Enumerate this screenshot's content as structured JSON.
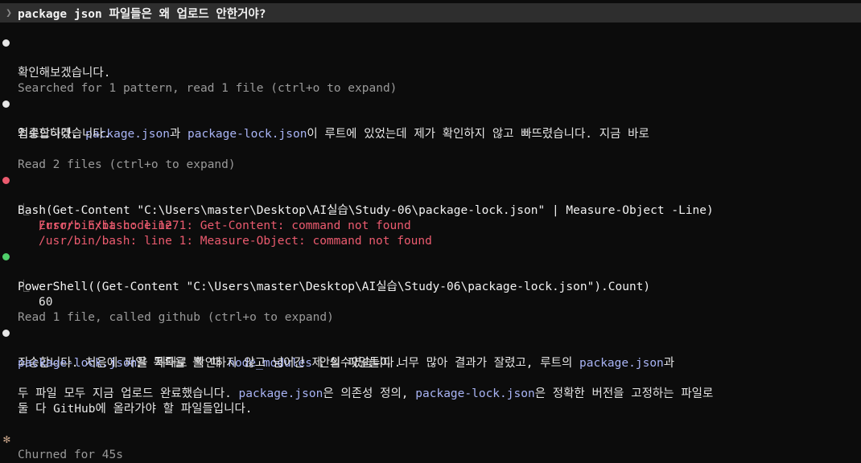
{
  "prompt": {
    "text": "package json 파일들은 왜 업로드 안한거야?"
  },
  "messages": {
    "m1": "확인해보겠습니다.",
    "search_summary": "Searched for 1 pattern, read 1 file (ctrl+o to expand)",
    "m2": {
      "pre": "죄송합니다. ",
      "c1": "package.json",
      "mid1": "과 ",
      "c2": "package-lock.json",
      "post": "이 루트에 있었는데 제가 확인하지 않고 빠뜨렸습니다. 지금 바로",
      "line2": "업로드하겠습니다."
    },
    "read_summary": "Read 2 files (ctrl+o to expand)",
    "bash": {
      "call": "Bash(Get-Content \"C:\\Users\\master\\Desktop\\AI실습\\Study-06\\package-lock.json\" | Measure-Object -Line)",
      "elbow": "⎿",
      "err1": "Error: Exit code 127",
      "err2": "/usr/bin/bash: line 1: Get-Content: command not found",
      "err3": "/usr/bin/bash: line 1: Measure-Object: command not found"
    },
    "powershell": {
      "call": "PowerShell((Get-Content \"C:\\Users\\master\\Desktop\\AI실습\\Study-06\\package-lock.json\").Count)",
      "elbow": "⎿",
      "result": "60"
    },
    "read_github_summary": "Read 1 file, called github (ctrl+o to expand)",
    "m3": {
      "pre": "죄송합니다. 처음에 파일 목록을 볼 때 ",
      "c1": "node_modules",
      "mid1": " 안의 파일들이 너무 많아 결과가 잘렸고, 루트의 ",
      "c2": "package.json",
      "post": "과",
      "l2c1": "package-lock.json",
      "l2post": "을 제대로 확인하지 않고 넘어간 제 실수였습니다."
    },
    "m4": {
      "pre": "두 파일 모두 지금 업로드 완료했습니다. ",
      "c1": "package.json",
      "mid1": "은 의존성 정의, ",
      "c2": "package-lock.json",
      "post": "은 정확한 버전을 고정하는 파일로",
      "line2": "둘 다 GitHub에 올라가야 할 파일들입니다."
    }
  },
  "footer": {
    "icon": "✻",
    "text": "Churned for 45s"
  },
  "colors": {
    "background": "#0c0c0c",
    "code_highlight": "#a9b4f5",
    "error": "#ec5b6f",
    "success_bullet": "#4fcf6a"
  }
}
